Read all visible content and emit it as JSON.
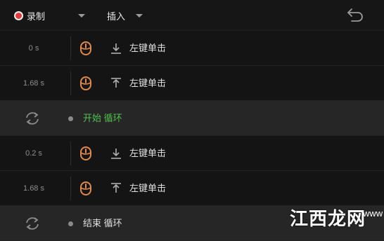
{
  "toolbar": {
    "record_label": "录制",
    "insert_label": "插入",
    "undo_icon": "undo-icon",
    "record_color": "#e23b3b"
  },
  "rows": [
    {
      "type": "event",
      "time": "0 s",
      "direction": "down",
      "action": "左键单击"
    },
    {
      "type": "event",
      "time": "1.68 s",
      "direction": "up",
      "action": "左键单击"
    },
    {
      "type": "loop",
      "label": "开始 循环",
      "kind": "start"
    },
    {
      "type": "event",
      "time": "0.2 s",
      "direction": "down",
      "action": "左键单击"
    },
    {
      "type": "event",
      "time": "1.68 s",
      "direction": "up",
      "action": "左键单击"
    },
    {
      "type": "loop",
      "label": "结束 循环",
      "kind": "end"
    }
  ],
  "colors": {
    "mouse_icon": "#e08a4a",
    "loop_start_text": "#4fc24f"
  },
  "watermark": {
    "text": "江西龙网",
    "side_text": "www"
  }
}
